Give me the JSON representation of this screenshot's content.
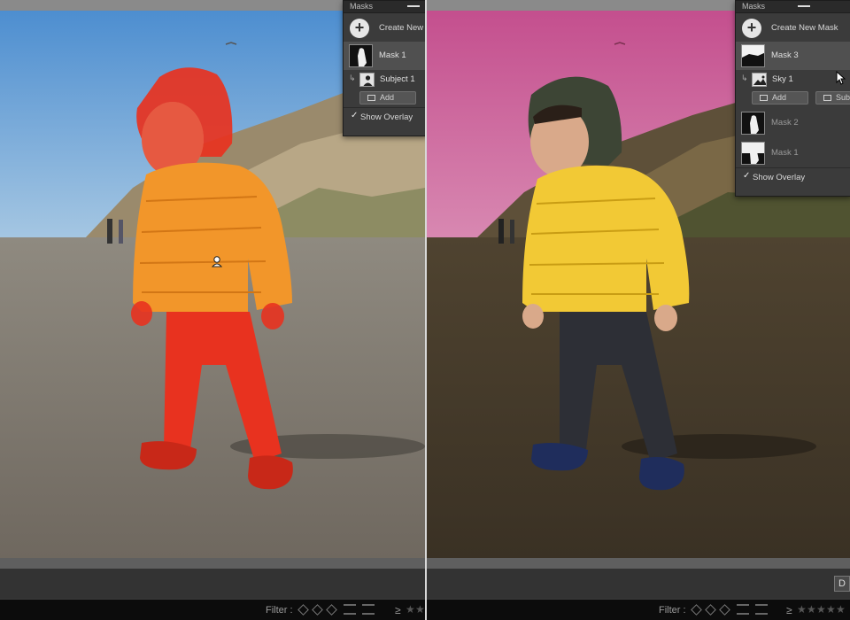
{
  "left_panel": {
    "header": "Masks",
    "create_label": "Create New Mask",
    "masks": [
      {
        "name": "Mask 1",
        "selected": true,
        "thumb": "subject-silhouette-thumbnail"
      }
    ],
    "components": [
      {
        "name": "Subject 1",
        "thumb": "person-icon"
      }
    ],
    "buttons": {
      "add": "Add"
    },
    "show_overlay": {
      "label": "Show Overlay",
      "checked": true
    },
    "overlay_color": "#e8321f"
  },
  "right_panel": {
    "header": "Masks",
    "create_label": "Create New Mask",
    "masks": [
      {
        "name": "Mask 3",
        "selected": true,
        "thumb": "sky-mask-thumbnail"
      },
      {
        "name": "Mask 2",
        "selected": false,
        "thumb": "subject-mask-thumbnail"
      },
      {
        "name": "Mask 1",
        "selected": false,
        "thumb": "subject-mask-thumbnail"
      }
    ],
    "components": [
      {
        "name": "Sky 1",
        "thumb": "landscape-icon"
      }
    ],
    "buttons": {
      "add": "Add",
      "subtract": "Subt"
    },
    "show_overlay": {
      "label": "Show Overlay",
      "checked": true
    },
    "overlay_color": "#d45d9a"
  },
  "filmstrip": {
    "filter_label": "Filter :",
    "geq": "≥",
    "d_button": "D"
  },
  "icons": {
    "add": "plus-circle-icon",
    "minimize": "minimize-icon",
    "check": "checkmark-icon",
    "component_link": "link-arrow-icon",
    "brush": "brush-icon",
    "pin": "mask-pin-icon",
    "cursor": "mouse-cursor-icon"
  }
}
